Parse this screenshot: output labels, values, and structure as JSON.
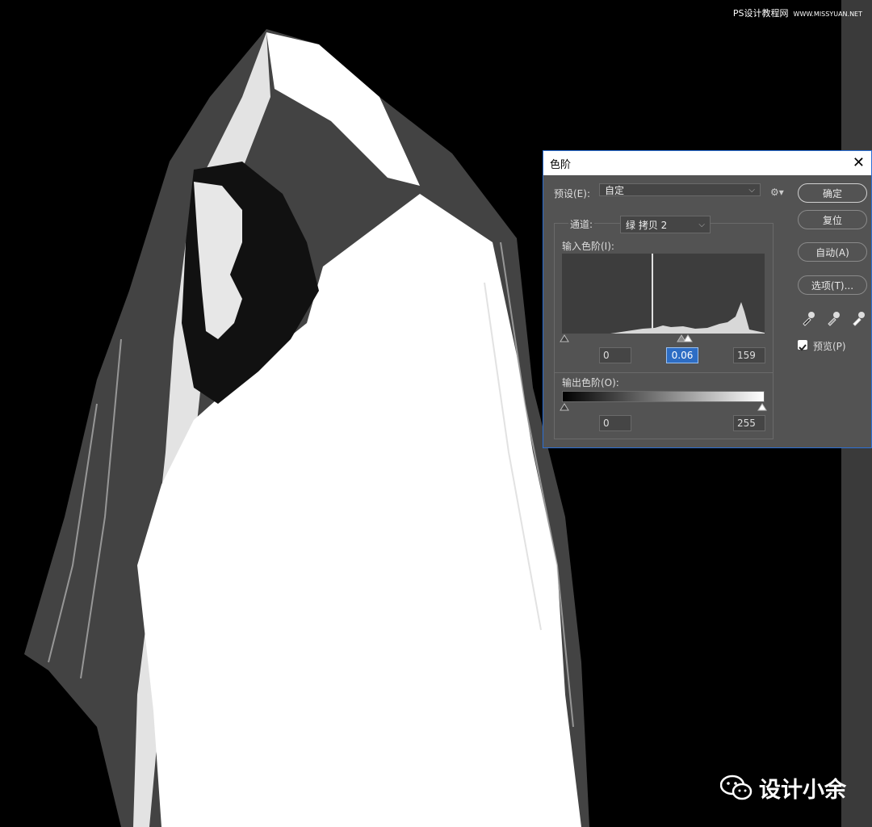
{
  "watermark": {
    "top_site": "PS设计教程网",
    "top_url": "WWW.MISSYUAN.NET",
    "bottom_name": "设计小余"
  },
  "dialog": {
    "title": "色阶",
    "preset_label": "预设(E):",
    "preset_value": "自定",
    "channel_label": "通道:",
    "channel_value": "绿 拷贝 2",
    "input_label": "输入色阶(I):",
    "input_black": "0",
    "input_gamma": "0.06",
    "input_white": "159",
    "output_label": "输出色阶(O):",
    "output_black": "0",
    "output_white": "255",
    "buttons": {
      "ok": "确定",
      "reset": "复位",
      "auto": "自动(A)",
      "options": "选项(T)..."
    },
    "preview_label": "预览(P)",
    "preview_checked": true
  },
  "colors": {
    "dialog_bg": "#535353",
    "accent": "#2d6dc4"
  }
}
